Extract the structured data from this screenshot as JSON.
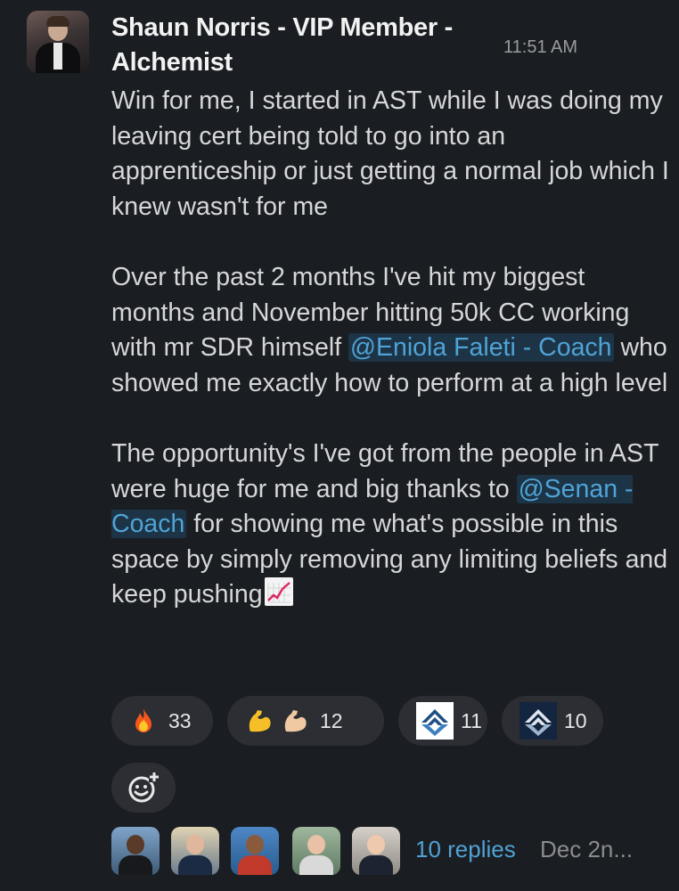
{
  "message": {
    "author": "Shaun Norris - VIP Member - Alchemist",
    "time": "11:51 AM",
    "p1": "Win for me, I started in AST while I was doing my leaving cert being told to go into an apprenticeship or just getting a normal job which I knew wasn't for me",
    "p2_before": "Over the past 2 months I've hit my biggest months and November hitting 50k CC working with mr SDR himself ",
    "p2_mention": "@Eniola Faleti - Coach",
    "p2_after": " who showed me exactly how to perform at a high level",
    "p3_before": "The opportunity's I've got from the people in AST were huge for me and big thanks to ",
    "p3_mention": "@Senan - Coach",
    "p3_after": " for showing me what's possible in this space by simply removing any limiting beliefs and keep pushing"
  },
  "reactions": [
    {
      "emoji": "fire-emoji",
      "count": "33"
    },
    {
      "emoji": "flexed-biceps-emoji",
      "count": "12"
    },
    {
      "emoji": "ast-logo-light",
      "count": "11"
    },
    {
      "emoji": "ast-logo-dark",
      "count": "10"
    }
  ],
  "thread": {
    "replies": "10 replies",
    "date": "Dec 2n..."
  },
  "colors": {
    "background": "#1a1d21",
    "mention": "#4fa3d6",
    "pill": "#2c2e33"
  }
}
